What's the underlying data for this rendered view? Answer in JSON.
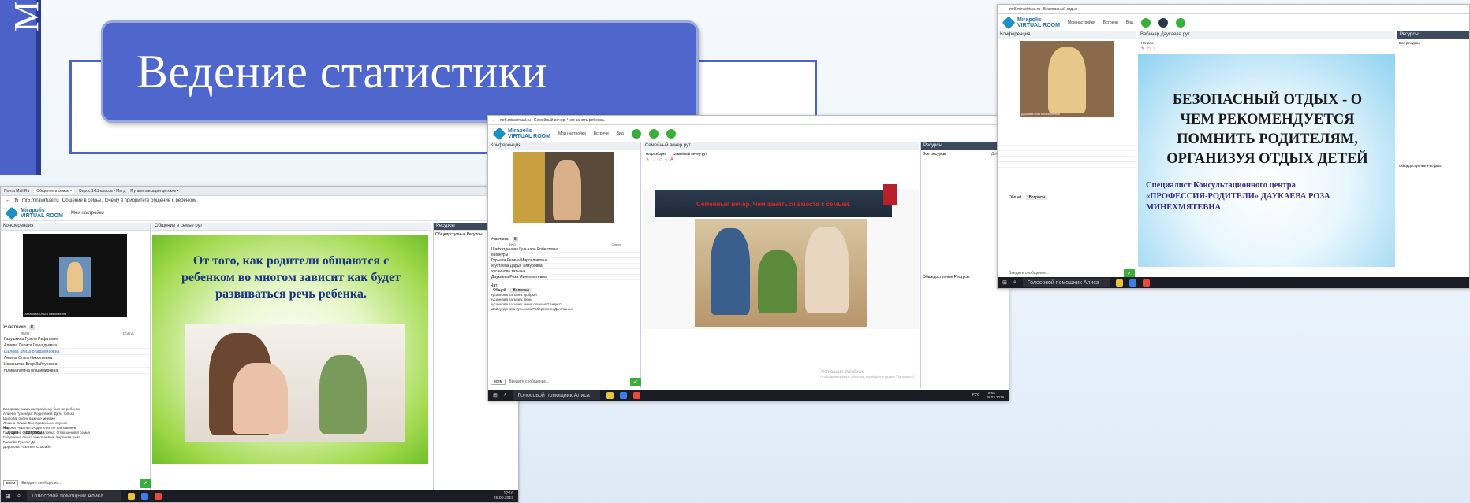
{
  "slide": {
    "title": "Ведение статистики",
    "side_letter": "М"
  },
  "shot_left": {
    "tabs": [
      "Почта Mail.Ru",
      "Общение в семье • ",
      "Опрос 1-11 класса • Мы д",
      "Мультипликация детское •"
    ],
    "url": "mr5.miravirtual.ru",
    "page_title": "Общение в семье.Почему в приоритете общение с ребенком.",
    "app_menu": "Мои настройки",
    "panels": {
      "conf": "Конференция",
      "room": "Общение в семье рут",
      "res": "Ресурсы",
      "res_section": "Общедоступные Ресурсы"
    },
    "video_name": "Захарова Ольга Николаевна",
    "participants_label": "Участники",
    "participants_count": "8",
    "col_fio": "ФИО",
    "col_status": "Статус",
    "participants": [
      "Галушкина Гузель Рифатовна",
      "Алиева Лариса Геннадьевна",
      "Шилова Элиза Владимировна",
      "Ликина Ольга Николаевна",
      "Исмаилова Бизр Зайтуновна",
      "галина галина владимировна"
    ],
    "slide_text": "От того, как родители общаются с ребенком во многом зависит как будет развиваться речь ребенка.",
    "chat_label": "Чат",
    "chat_tab_general": "Общий",
    "chat_tab_questions": "Вопросы",
    "chat_lines": [
      "Багирова: мама на проблему был на ребенок",
      "Алиева Гульнара: Родителей. Дети только",
      "Шилова: очень важное мнение",
      "Ликина Ольга: Все правильно, верное",
      "Бирова Розалия: Родителей не наставляем",
      "Галушкина Ольга Михайловна: Отношения в семье",
      "Галушкина Ольга Николаевна: Хорошая тема",
      "Галиева Гузель: Да",
      "Дорохова Розалия: Спасибо",
      "Галиакова Гузель: Хорошего",
      "Галушкина Гузель: Спасибо"
    ],
    "chat_input_placeholder": "Введите сообщение...",
    "chat_send_label": "всем",
    "taskbar_search": "Голосовой помощник Алиса",
    "clock_time": "12:16",
    "clock_date": "26.03.2019"
  },
  "shot_mid": {
    "url": "mr5.miravirtual.ru",
    "page_title": "Семейный вечер. Чем занять ребенка.",
    "app_menus": [
      "Мои настройки",
      "Встречи",
      "Вид"
    ],
    "panels": {
      "conf": "Конференция",
      "room": "Семейный вечер рут",
      "res": "Ресурсы"
    },
    "room_tabs": [
      "На разборке",
      "Семейный вечер рут"
    ],
    "participants_label": "Участники",
    "participants_count": "8",
    "col_fio": "ФИО",
    "col_status": "Статус",
    "participants": [
      "Шайхутдинова Гульнара Робертовна",
      "Миннуры",
      "Гурьева Регина Мирославовна",
      "Мустаева Дарья Тимуровна",
      "хусаинова татьяна",
      "Даукаева Роза Минехмятевна"
    ],
    "slide_banner": "Семейный вечер. Чем заняться вместе с семьей.",
    "resources_all": "Все ресурсы",
    "resources_add": "Добавить",
    "resources_public": "Общедоступные Ресурсы",
    "activation_title": "Активация Windows",
    "activation_text": "Чтобы активировать Windows, перейдите в раздел \"Параметры\".",
    "chat_label": "Чат",
    "chat_tab_general": "Общий",
    "chat_tab_questions": "Вопросы",
    "chat_lines": [
      "хусаинова татьяна: добрый",
      "хусаинова татьяна: день",
      "хусаинова татьяна: меня слышно? видно?",
      "Шайхутдинова Гульнара Робертовна: Да слышно"
    ],
    "chat_input_placeholder": "Введите сообщение...",
    "chat_send_label": "всем",
    "taskbar_search": "Голосовой помощник Алиса",
    "clock_time": "18:50",
    "clock_date": "26.03.2019",
    "lang": "РУС"
  },
  "shot_right": {
    "url": "mr5.miravirtual.ru",
    "page_title": "Безопасный отдых",
    "app_menus": [
      "Мои настройки",
      "Встречи",
      "Вид"
    ],
    "panels": {
      "conf": "Конференция",
      "room": "Вебинар Даукаева рут",
      "res": "Ресурсы"
    },
    "room_tabs": [
      "Начало"
    ],
    "video_name": "Даукаева Роза Минехмятевна",
    "slide_heading": "БЕЗОПАСНЫЙ ОТДЫХ - О ЧЕМ РЕКОМЕНДУЕТСЯ ПОМНИТЬ РОДИТЕЛЯМ, ОРГАНИЗУЯ ОТДЫХ ДЕТЕЙ",
    "slide_sub": "Специалист Консультационного центра «ПРОФЕССИЯ-РОДИТЕЛИ» ДАУКАЕВА РОЗА МИНЕХМЯТЕВНА",
    "chat_tab_general": "Общий",
    "chat_tab_questions": "Вопросы",
    "chat_input_placeholder": "Введите сообщение...",
    "resources_all": "Все ресурсы",
    "resources_public": "Общедоступные Ресурсы",
    "taskbar_search": "Голосовой помощник Алиса"
  }
}
